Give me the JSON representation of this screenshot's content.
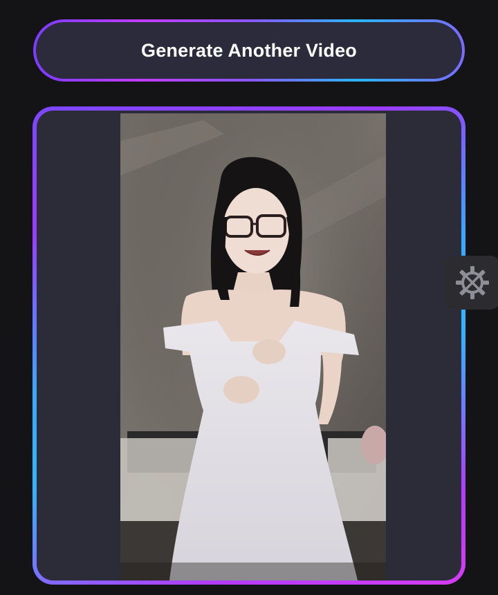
{
  "actions": {
    "generate_label": "Generate Another Video"
  },
  "video": {
    "icon": "video-frame"
  },
  "floating": {
    "icon": "gear-wrench-icon"
  },
  "colors": {
    "background": "#141416",
    "button_fill": "#2b2b3b",
    "card_fill": "#2c2c38",
    "gradient_purple": "#7b3cff",
    "gradient_magenta": "#c23cff",
    "gradient_blue": "#29b6ff"
  }
}
